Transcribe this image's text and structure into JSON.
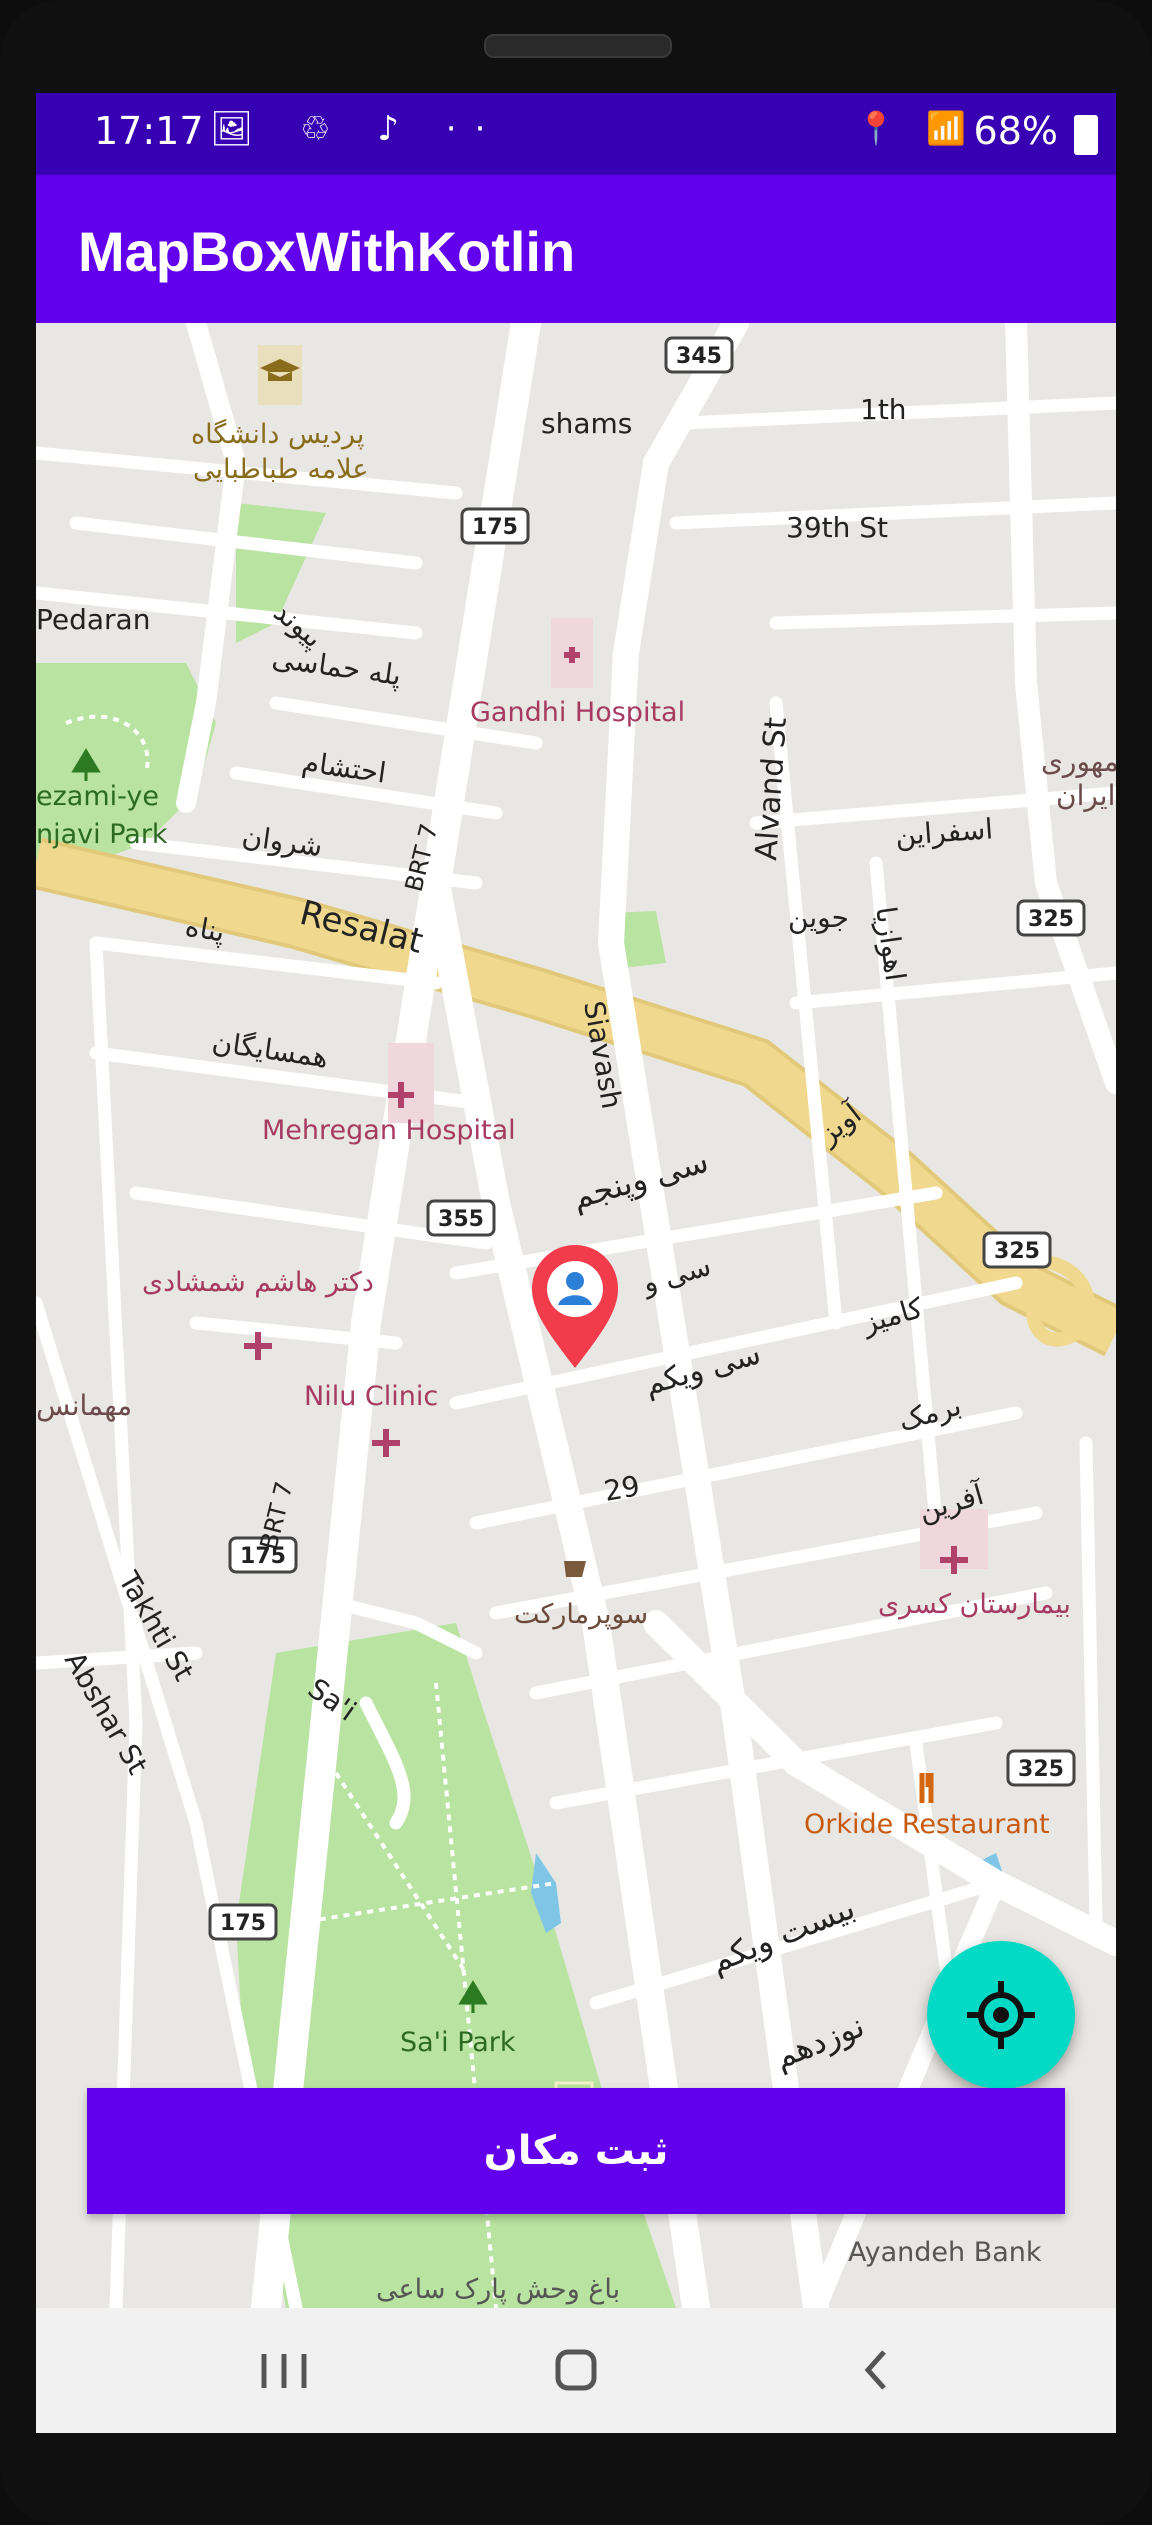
{
  "status_bar": {
    "time": "17:17",
    "left_icons": "🖼 ♲ ♪ ··",
    "right_icons": "📍 📶",
    "battery": "68%"
  },
  "app_bar": {
    "title": "MapBoxWithKotlin"
  },
  "map": {
    "streets": {
      "shams": "shams",
      "s1th": "1th",
      "s39th": "39th St",
      "pedaran": "Pedaran",
      "pivand": "پیوند",
      "pele": "پله حماسی",
      "ehtesham": "احتشام",
      "sharvan": "شروان",
      "panah": "پناه",
      "hamsayegan": "همسایگان",
      "resalat": "Resalat",
      "brt7_top": "BRT 7",
      "brt7_bottom": "BRT 7",
      "alvand": "Alvand St",
      "esfarayen": "اسفراین",
      "jovein": "جوین",
      "ahvazi": "اهوازیا",
      "siavash": "Siavash",
      "aviz": "آویز",
      "si_panjom": "سی وپنجم",
      "si_o": "سی و",
      "si_yekom": "سی ویکم",
      "kamyez": "کامیز",
      "barmak": "برمک",
      "afarin": "آفرین",
      "s29": "29",
      "takhti": "Takhti St",
      "abshar": "Abshar St",
      "sai": "Sa'i",
      "bist_yekom": "بیست ویکم",
      "nozdahom": "نوزدهم",
      "mehmanan": "مهمانس",
      "jomhouri": "جمهوری",
      "iran": "ایران"
    },
    "route_shields": {
      "r345": "345",
      "r175_a": "175",
      "r175_b": "175",
      "r175_c": "175",
      "r355": "355",
      "r325_a": "325",
      "r325_b": "325",
      "r325_c": "325"
    },
    "pois": {
      "university_1": "پردیس دانشگاه",
      "university_2": "علامه طباطبایی",
      "gandhi": "Gandhi Hospital",
      "mehregan": "Mehregan Hospital",
      "hashem": "دکتر هاشم شمشادی",
      "nilu": "Nilu Clinic",
      "supermarket": "سوپرمارکت",
      "kasra": "بیمارستان کسری",
      "orkide": "Orkide Restaurant",
      "sai_park": "Sa'i Park",
      "nezami_1": "ezami-ye",
      "nezami_2": "njavi Park",
      "ayandeh": "Ayandeh Bank",
      "zoo": "باغ وحش پارک ساعی"
    },
    "colors": {
      "land": "#e9e7e3",
      "park": "#b9e3a0",
      "road": "#ffffff",
      "highway": "#f0d98f",
      "hospital": "#b0416a",
      "marker": "#f23c4b"
    }
  },
  "fab": {
    "icon": "my-location-icon",
    "color": "#03DAC5"
  },
  "save_button": {
    "label": "ثبت مکان"
  },
  "nav_bar": {
    "recents": "recents-icon",
    "home": "home-icon",
    "back": "back-icon"
  }
}
